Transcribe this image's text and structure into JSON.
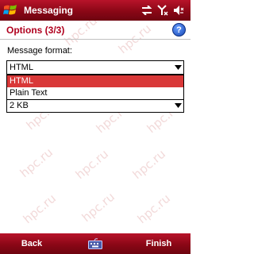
{
  "titlebar": {
    "title": "Messaging",
    "icons": [
      "windows-start-icon",
      "connectivity-icon",
      "signal-off-icon",
      "volume-off-icon"
    ]
  },
  "header": {
    "title": "Options (3/3)",
    "help_label": "?"
  },
  "form": {
    "format_label": "Message format:",
    "format_value": "HTML",
    "format_options": [
      "HTML",
      "Plain Text"
    ],
    "selected_option": "HTML",
    "size_value": "2 KB"
  },
  "watermark": {
    "text": "hpc.ru"
  },
  "menubar": {
    "left_softkey": "Back",
    "right_softkey": "Finish",
    "center_icon": "keyboard-icon"
  },
  "colors": {
    "bar": "#8a0716",
    "title_text": "#b0001e",
    "selection": "#d93838"
  }
}
